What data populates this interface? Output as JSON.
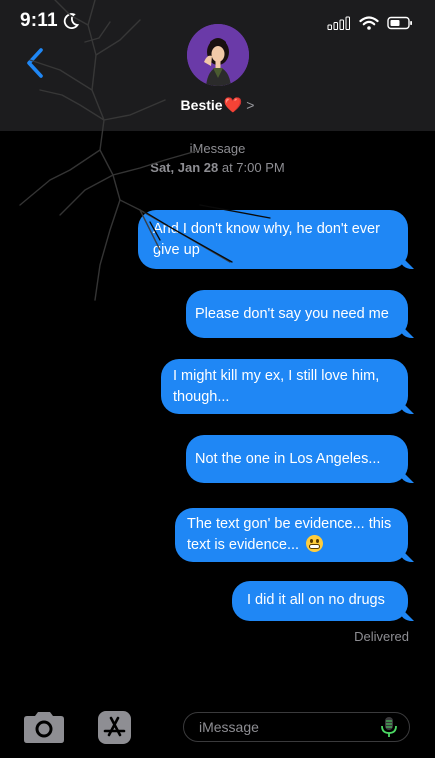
{
  "status_bar": {
    "time": "9:11",
    "moon_icon": "moon-icon",
    "signal_icon": "signal-icon",
    "wifi_icon": "wifi-icon",
    "battery_icon": "battery-icon"
  },
  "header": {
    "back_icon": "chevron-left-icon",
    "contact_name": "Bestie",
    "contact_heart": "❤️",
    "contact_chevron": ">"
  },
  "conversation": {
    "service_label": "iMessage",
    "date_day": "Sat, Jan 28",
    "date_at": "at 7:00 PM",
    "messages": [
      {
        "text": "And I don't know why, he don't ever give up"
      },
      {
        "text": "Please don't say you need me"
      },
      {
        "text": "I might kill my ex, I still love him, though..."
      },
      {
        "text": "Not the one in Los Angeles..."
      },
      {
        "text": "The text gon' be evidence... this text is evidence...",
        "emoji": "grimacing-emoji"
      },
      {
        "text": "I did it all on no drugs"
      }
    ],
    "delivery_status": "Delivered"
  },
  "composer": {
    "camera_icon": "camera-icon",
    "appstore_icon": "appstore-icon",
    "placeholder": "iMessage",
    "mic_icon": "microphone-icon"
  },
  "colors": {
    "bubble": "#1f87f5",
    "header_bg": "#1c1c1e",
    "accent": "#1f87f5",
    "secondary_text": "#8e8e93",
    "heart": "#ff1f2e"
  }
}
